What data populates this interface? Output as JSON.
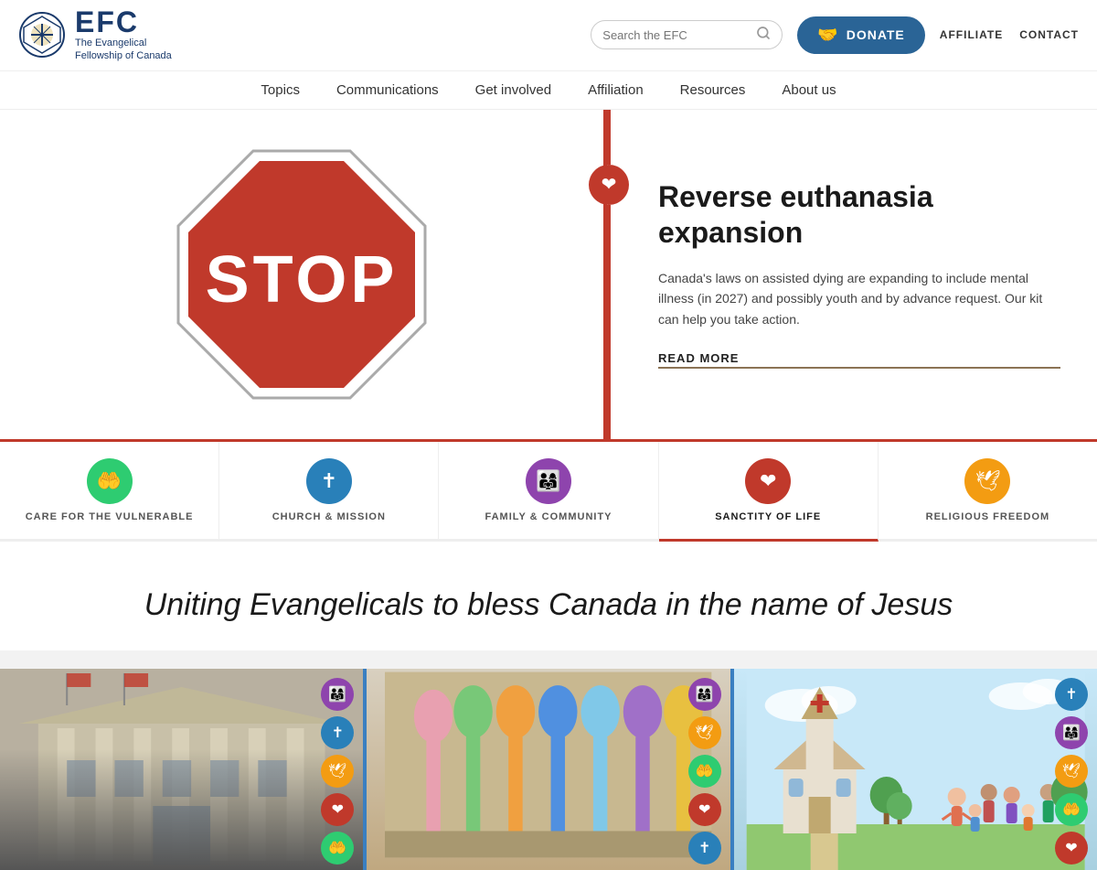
{
  "header": {
    "logo_efc": "EFC",
    "logo_subtitle_line1": "The Evangelical",
    "logo_subtitle_line2": "Fellowship of Canada",
    "search_placeholder": "Search the EFC",
    "donate_label": "DONATE",
    "affiliate_label": "AFFILIATE",
    "contact_label": "CONTACT"
  },
  "nav": {
    "items": [
      {
        "label": "Topics"
      },
      {
        "label": "Communications"
      },
      {
        "label": "Get involved"
      },
      {
        "label": "Affiliation"
      },
      {
        "label": "Resources"
      },
      {
        "label": "About us"
      }
    ]
  },
  "hero": {
    "stop_text": "STOP",
    "title": "Reverse euthanasia expansion",
    "description": "Canada's laws on assisted dying are expanding to include mental illness (in 2027) and possibly youth and by advance request. Our kit can help you take action.",
    "read_more": "READ MORE"
  },
  "topics": [
    {
      "label": "CARE FOR THE VULNERABLE",
      "color": "#2ecc71",
      "icon": "🤲",
      "active": false
    },
    {
      "label": "CHURCH & MISSION",
      "color": "#2980b9",
      "icon": "✝",
      "active": false
    },
    {
      "label": "FAMILY & COMMUNITY",
      "color": "#8e44ad",
      "icon": "👨‍👩‍👧",
      "active": false
    },
    {
      "label": "SANCTITY OF LIFE",
      "color": "#c0392b",
      "icon": "❤",
      "active": true
    },
    {
      "label": "RELIGIOUS FREEDOM",
      "color": "#f39c12",
      "icon": "🕊",
      "active": false
    }
  ],
  "tagline": "Uniting Evangelicals to bless Canada in the name of Jesus",
  "cards": [
    {
      "id": "card-1",
      "icons": [
        {
          "color": "#8e44ad",
          "icon": "👨‍👩‍👧"
        },
        {
          "color": "#2980b9",
          "icon": "✝"
        },
        {
          "color": "#f39c12",
          "icon": "🕊"
        },
        {
          "color": "#c0392b",
          "icon": "❤"
        },
        {
          "color": "#2ecc71",
          "icon": "🤲"
        }
      ]
    },
    {
      "id": "card-2",
      "paddle_colors": [
        "#e74c3c",
        "#e67e22",
        "#27ae60",
        "#3498db",
        "#9b59b6"
      ],
      "icons": [
        {
          "color": "#8e44ad",
          "icon": "👨‍👩‍👧"
        },
        {
          "color": "#f39c12",
          "icon": "🕊"
        },
        {
          "color": "#2ecc71",
          "icon": "🤲"
        },
        {
          "color": "#c0392b",
          "icon": "❤"
        },
        {
          "color": "#2980b9",
          "icon": "✝"
        }
      ]
    },
    {
      "id": "card-3",
      "icons": [
        {
          "color": "#2980b9",
          "icon": "✝"
        },
        {
          "color": "#8e44ad",
          "icon": "👨‍👩‍👧"
        },
        {
          "color": "#f39c12",
          "icon": "🕊"
        },
        {
          "color": "#2ecc71",
          "icon": "🤲"
        },
        {
          "color": "#c0392b",
          "icon": "❤"
        }
      ]
    }
  ]
}
